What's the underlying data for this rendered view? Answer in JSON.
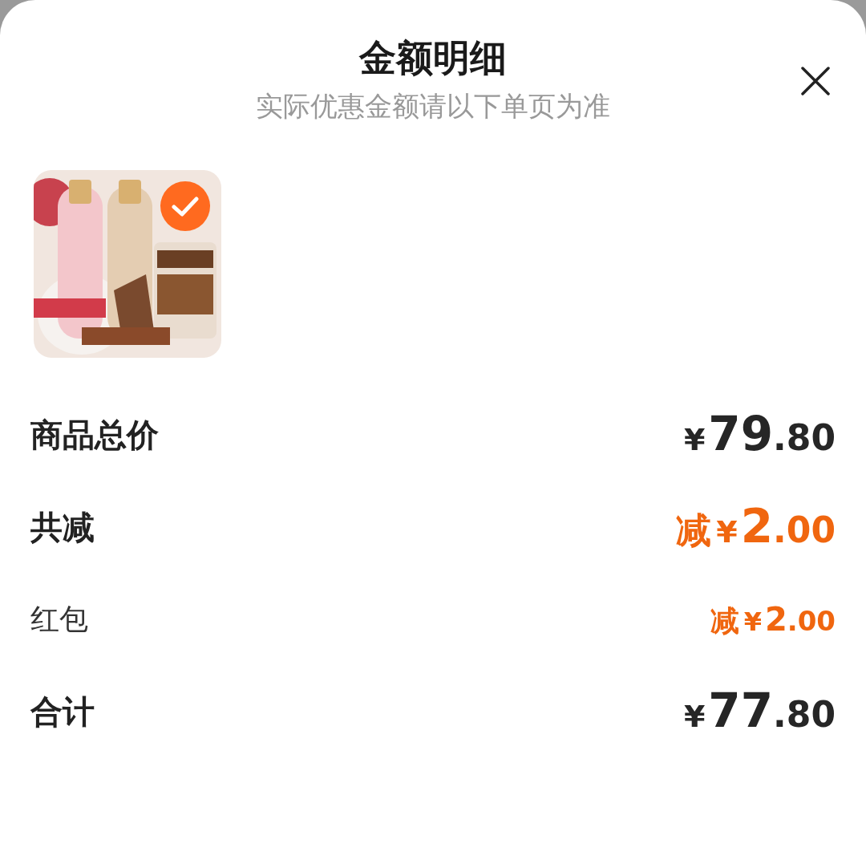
{
  "sheet": {
    "title": "金额明细",
    "subtitle": "实际优惠金额请以下单页为准"
  },
  "product": {
    "selected": true
  },
  "rows": [
    {
      "label": "商品总价",
      "kind": "major",
      "color": "#262626",
      "prefix": "",
      "currency": "¥",
      "integer": "79",
      "decimal": ".80"
    },
    {
      "label": "共减",
      "kind": "major",
      "color": "#f0660f",
      "prefix": "减",
      "currency": "¥",
      "integer": "2",
      "decimal": ".00"
    },
    {
      "label": "红包",
      "kind": "minor",
      "color": "#f0660f",
      "prefix": "减",
      "currency": "¥",
      "integer": "2",
      "decimal": ".00"
    },
    {
      "label": "合计",
      "kind": "major",
      "color": "#262626",
      "prefix": "",
      "currency": "¥",
      "integer": "77",
      "decimal": ".80"
    }
  ]
}
